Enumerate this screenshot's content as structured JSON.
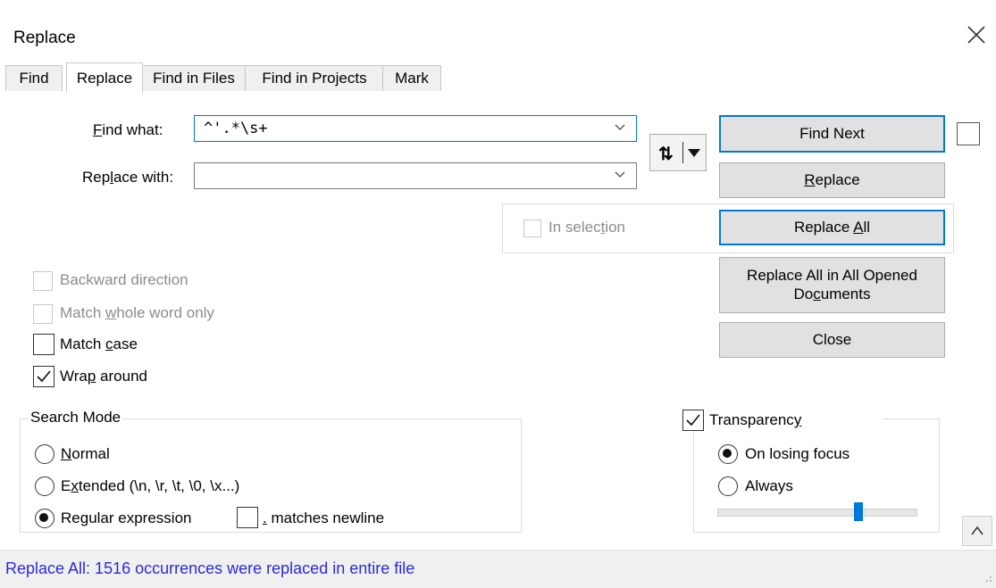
{
  "window": {
    "title": "Replace"
  },
  "tabs": [
    {
      "label": "Find"
    },
    {
      "label": "Replace"
    },
    {
      "label": "Find in Files"
    },
    {
      "label": "Find in Projects"
    },
    {
      "label": "Mark"
    }
  ],
  "find_what": {
    "label_pre": "",
    "label_ul": "F",
    "label_post": "ind what:",
    "value": "^'.*\\s+"
  },
  "replace_with": {
    "label_pre": "Rep",
    "label_ul": "l",
    "label_post": "ace with:",
    "value": ""
  },
  "swap_button": {
    "icon": "swap-arrows-icon",
    "glyph": "⇅"
  },
  "buttons": {
    "find_next": "Find Next",
    "replace_pre": "",
    "replace_ul": "R",
    "replace_post": "eplace",
    "replace_all_pre": "Replace ",
    "replace_all_ul": "A",
    "replace_all_post": "ll",
    "replace_all_opened_line1": "Replace All in All Opened",
    "replace_all_opened_line2_pre": "Do",
    "replace_all_opened_line2_ul": "c",
    "replace_all_opened_line2_post": "uments",
    "close": "Close"
  },
  "in_selection": {
    "pre": "In selec",
    "ul": "t",
    "post": "ion",
    "checked": false,
    "enabled": false
  },
  "options": {
    "backward": {
      "label": "Backward direction",
      "checked": false,
      "enabled": false
    },
    "whole_word": {
      "pre": "Match ",
      "ul": "w",
      "post": "hole word only",
      "checked": false,
      "enabled": false
    },
    "match_case": {
      "pre": "Match ",
      "ul": "c",
      "post": "ase",
      "checked": false,
      "enabled": true
    },
    "wrap_around": {
      "pre": "Wra",
      "ul": "p",
      "post": " around",
      "checked": true,
      "enabled": true
    }
  },
  "search_mode": {
    "title": "Search Mode",
    "normal": {
      "pre": "",
      "ul": "N",
      "post": "ormal",
      "selected": false
    },
    "extended": {
      "pre": "E",
      "ul": "x",
      "post": "tended (\\n, \\r, \\t, \\0, \\x...)",
      "selected": false
    },
    "regex": {
      "pre": "Re",
      "ul": "g",
      "post": "ular expression",
      "selected": true
    },
    "matches_newline": {
      "ul": ".",
      "post": " matches newline",
      "checked": false
    }
  },
  "transparency": {
    "pre": "Transparenc",
    "ul": "y",
    "post": "",
    "checked": true,
    "on_losing_focus": "On losing focus",
    "on_losing_focus_selected": true,
    "always": "Always",
    "always_selected": false,
    "slider_level": 0.72
  },
  "collapse_button": {
    "glyph": "^"
  },
  "status": {
    "text": "Replace All: 1516 occurrences were replaced in entire file"
  },
  "colors": {
    "accent": "#0078d7",
    "status_text": "#2b2bd6",
    "button_face": "#e1e1e1"
  }
}
